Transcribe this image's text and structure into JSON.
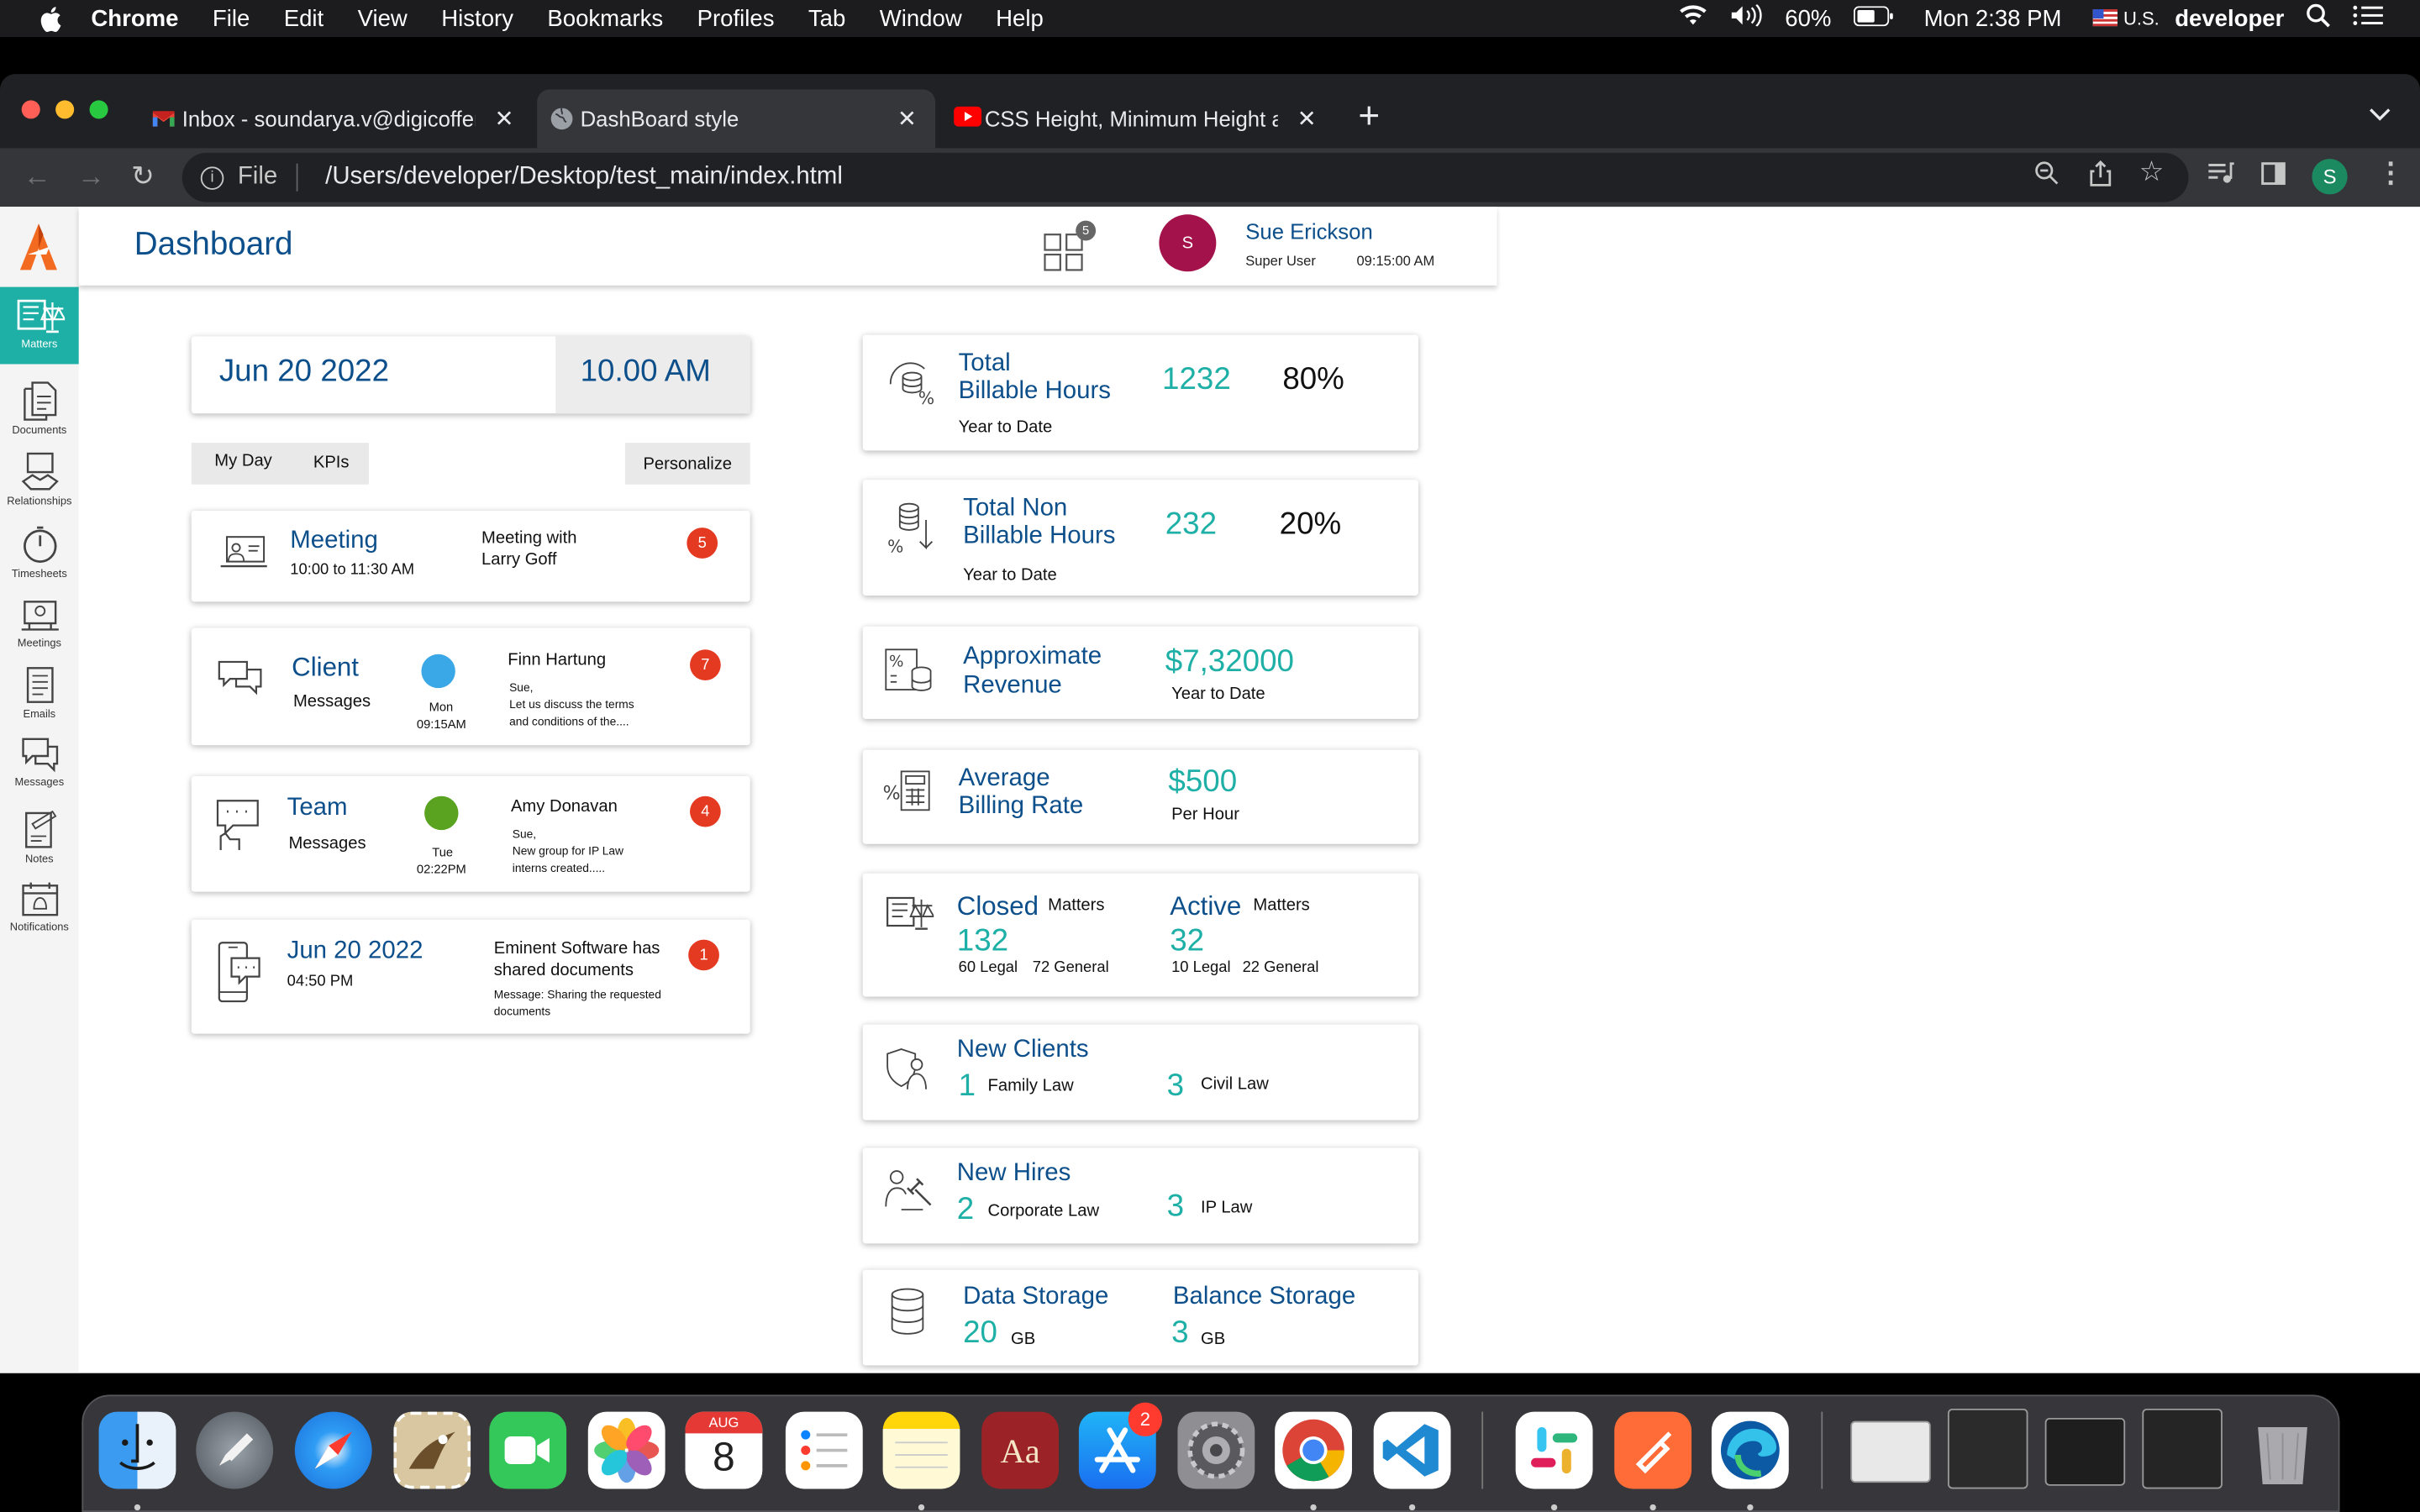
{
  "menubar": {
    "app": "Chrome",
    "items": [
      "File",
      "Edit",
      "View",
      "History",
      "Bookmarks",
      "Profiles",
      "Tab",
      "Window",
      "Help"
    ],
    "battery": "60%",
    "clock": "Mon 2:38 PM",
    "input_source": "U.S.",
    "user": "developer"
  },
  "browser": {
    "tabs": [
      {
        "title": "Inbox - soundarya.v@digicoffer"
      },
      {
        "title": "DashBoard style"
      },
      {
        "title": "CSS Height, Minimum Height and"
      }
    ],
    "url_prefix": "File",
    "url": "/Users/developer/Desktop/test_main/index.html",
    "profile_initial": "S"
  },
  "app": {
    "page_title": "Dashboard",
    "apps_badge": "5",
    "user": {
      "initial": "S",
      "name": "Sue Erickson",
      "role": "Super User",
      "time": "09:15:00 AM"
    },
    "sidebar": [
      {
        "label": "Matters",
        "icon": "scales-icon"
      },
      {
        "label": "Documents",
        "icon": "documents-icon"
      },
      {
        "label": "Relationships",
        "icon": "handshake-icon"
      },
      {
        "label": "Timesheets",
        "icon": "timer-icon"
      },
      {
        "label": "Meetings",
        "icon": "meeting-icon"
      },
      {
        "label": "Emails",
        "icon": "email-icon"
      },
      {
        "label": "Messages",
        "icon": "messages-icon"
      },
      {
        "label": "Notes",
        "icon": "notes-icon"
      },
      {
        "label": "Notifications",
        "icon": "calendar-bell-icon"
      }
    ],
    "date_box": {
      "date": "Jun 20 2022",
      "time": "10.00 AM"
    },
    "tabs": [
      "My Day",
      "KPIs"
    ],
    "personalize": "Personalize",
    "feed": {
      "meeting": {
        "title": "Meeting",
        "time": "10:00 to 11:30 AM",
        "desc": [
          "Meeting with",
          "Larry Goff"
        ],
        "badge": "5"
      },
      "client": {
        "title": "Client",
        "subtitle": "Messages",
        "day": "Mon",
        "time": "09:15AM",
        "sender": "Finn Hartung",
        "lines": [
          "Sue,",
          "Let us discuss the terms",
          "and conditions of the...."
        ],
        "badge": "7",
        "dot_color": "#3aa8e6"
      },
      "team": {
        "title": "Team",
        "subtitle": "Messages",
        "day": "Tue",
        "time": "02:22PM",
        "sender": "Amy Donavan",
        "lines": [
          "Sue,",
          "New group for IP Law",
          "interns created....."
        ],
        "badge": "4",
        "dot_color": "#5aa320"
      },
      "doc": {
        "date": "Jun 20 2022",
        "time": "04:50 PM",
        "title": [
          "Eminent Software has",
          "shared documents"
        ],
        "message": [
          "Message: Sharing the requested",
          "documents"
        ],
        "badge": "1"
      }
    },
    "kpis": {
      "billable": {
        "title": [
          "Total",
          "Billable Hours"
        ],
        "sub": "Year to Date",
        "value": "1232",
        "percent": "80%"
      },
      "nonbillable": {
        "title": [
          "Total Non",
          "Billable Hours"
        ],
        "sub": "Year to Date",
        "value": "232",
        "percent": "20%"
      },
      "revenue": {
        "title": [
          "Approximate",
          "Revenue"
        ],
        "value": "$7,32000",
        "sub": "Year to Date"
      },
      "rate": {
        "title": [
          "Average",
          "Billing Rate"
        ],
        "value": "$500",
        "sub": "Per Hour"
      },
      "matters": {
        "closed": {
          "label": "Closed",
          "suffix": "Matters",
          "value": "132",
          "legal": "60 Legal",
          "general": "72 General"
        },
        "active": {
          "label": "Active",
          "suffix": "Matters",
          "value": "32",
          "legal": "10 Legal",
          "general": "22 General"
        }
      },
      "clients": {
        "title": "New Clients",
        "a_value": "1",
        "a_label": "Family Law",
        "b_value": "3",
        "b_label": "Civil Law"
      },
      "hires": {
        "title": "New Hires",
        "a_value": "2",
        "a_label": "Corporate Law",
        "b_value": "3",
        "b_label": "IP Law"
      },
      "storage": {
        "a_title": "Data Storage",
        "a_value": "20",
        "a_unit": "GB",
        "b_title": "Balance Storage",
        "b_value": "3",
        "b_unit": "GB"
      }
    }
  },
  "dock": {
    "calendar_month": "AUG",
    "calendar_day": "8",
    "appstore_badge": "2",
    "dictionary_label": "Aa"
  },
  "colors": {
    "brand_blue": "#0d4f8b",
    "teal": "#1eb0a6",
    "badge_red": "#e53a22",
    "avatar": "#a3124a"
  }
}
